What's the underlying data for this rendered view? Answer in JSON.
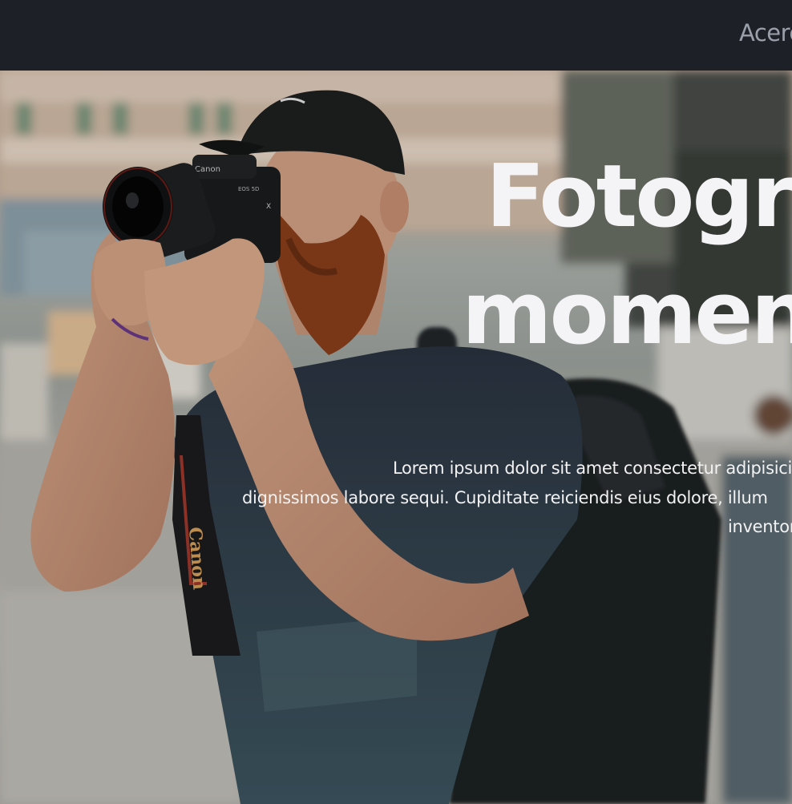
{
  "nav": {
    "link_label": "Acerca"
  },
  "hero": {
    "title_line1": "Fotografía",
    "title_line2": "momentos",
    "text_line1": "Lorem ipsum dolor sit amet consectetur adipisicing elit.",
    "text_line2": "dignissimos labore sequi. Cupiditate reiciendis eius dolore, illum",
    "text_line3": "inventore"
  },
  "colors": {
    "navbar_bg": "#1e2028",
    "nav_link": "#9aa0aa",
    "title": "#f4f4f6",
    "text": "#f2f2f2"
  }
}
